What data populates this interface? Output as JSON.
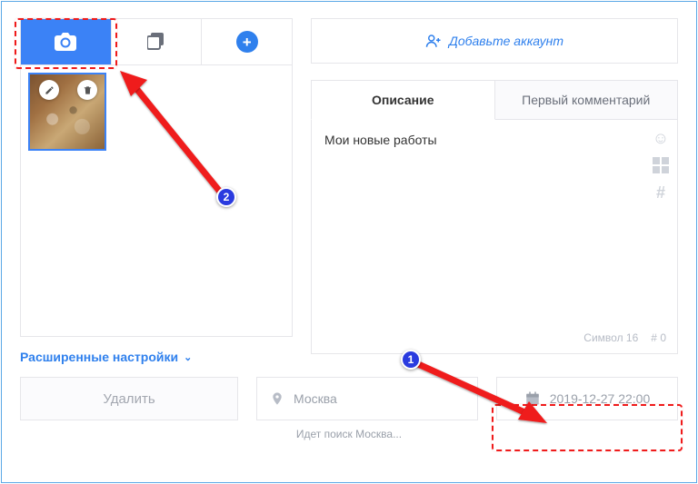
{
  "left": {
    "tabs": [
      "camera",
      "layers",
      "add"
    ]
  },
  "right": {
    "add_account": "Добавьте аккаунт",
    "tabs": {
      "desc": "Описание",
      "first_comment": "Первый комментарий"
    },
    "text": "Мои новые работы",
    "footer": {
      "symbol_label": "Символ",
      "symbol_count": "16",
      "hash_label": "#",
      "hash_count": "0"
    }
  },
  "adv_label": "Расширенные настройки",
  "delete_label": "Удалить",
  "location_placeholder": "Москва",
  "datetime": "2019-12-27 22:00",
  "status": "Идет поиск Москва...",
  "annotations": {
    "badge1": "1",
    "badge2": "2"
  }
}
